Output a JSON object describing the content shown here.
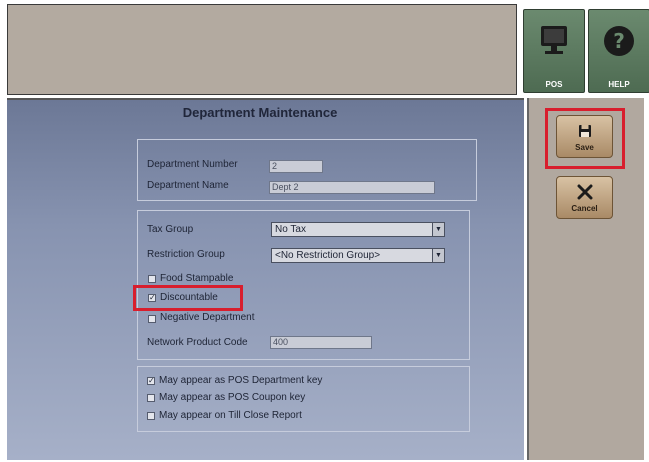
{
  "header": {
    "pos_label": "POS",
    "help_label": "HELP"
  },
  "form": {
    "title": "Department Maintenance",
    "department_number_label": "Department Number",
    "department_number_value": "2",
    "department_name_label": "Department Name",
    "department_name_value": "Dept 2",
    "tax_group_label": "Tax Group",
    "tax_group_value": "No Tax",
    "restriction_group_label": "Restriction Group",
    "restriction_group_value": "<No Restriction Group>",
    "food_stampable_label": "Food Stampable",
    "discountable_label": "Discountable",
    "negative_department_label": "Negative Department",
    "network_product_code_label": "Network Product Code",
    "network_product_code_value": "400",
    "pos_department_key_label": "May appear as POS Department key",
    "pos_coupon_key_label": "May appear as POS Coupon key",
    "till_close_report_label": "May appear on Till Close Report"
  },
  "checkboxes": {
    "food_stampable": false,
    "discountable": true,
    "negative_department": false,
    "pos_department_key": true,
    "pos_coupon_key": false,
    "till_close_report": false
  },
  "actions": {
    "save_label": "Save",
    "cancel_label": "Cancel"
  },
  "colors": {
    "highlight": "#d81e2d",
    "tile_green": "#5a7a5e",
    "button_tan": "#c3a987"
  },
  "icons": {
    "pos": "monitor-icon",
    "help": "question-icon",
    "save": "floppy-disk-icon",
    "cancel": "x-icon"
  }
}
